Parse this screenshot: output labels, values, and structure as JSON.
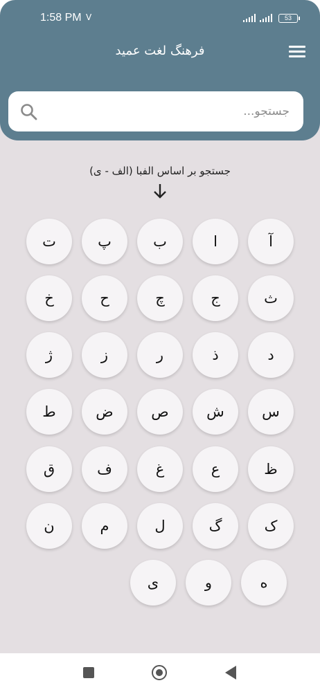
{
  "status_bar": {
    "time": "1:58 PM",
    "indicator": "V",
    "battery": "53"
  },
  "header": {
    "title": "فرهنگ لغت عمید",
    "menu_icon": "hamburger-menu-icon",
    "background_color": "#5d7e8f"
  },
  "search": {
    "placeholder": "جستجو...",
    "value": "",
    "icon": "search-icon"
  },
  "alphabet_section": {
    "instruction": "جستجو بر اساس الفبا (الف - ی)",
    "arrow_icon": "arrow-down-icon",
    "letters": [
      "آ",
      "ا",
      "ب",
      "پ",
      "ت",
      "ث",
      "ج",
      "چ",
      "ح",
      "خ",
      "د",
      "ذ",
      "ر",
      "ز",
      "ژ",
      "س",
      "ش",
      "ص",
      "ض",
      "ط",
      "ظ",
      "ع",
      "غ",
      "ف",
      "ق",
      "ک",
      "گ",
      "ل",
      "م",
      "ن",
      "ه",
      "و",
      "ی"
    ]
  },
  "nav_bar": {
    "items": [
      "recents-square-icon",
      "home-circle-icon",
      "back-triangle-icon"
    ]
  }
}
